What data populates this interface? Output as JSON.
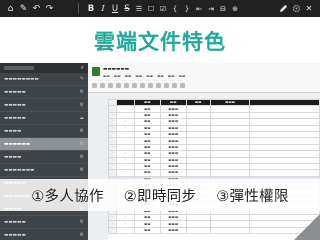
{
  "toolbar": {
    "left_icons": [
      "home-icon",
      "edit-square-icon",
      "undo-icon",
      "redo-icon"
    ],
    "format": [
      "B",
      "I",
      "U",
      "S"
    ],
    "format_icons": [
      "checklist-icon",
      "checkbox-icon",
      "checkbox-icon",
      "braces-icon",
      "code-icon",
      "outdent-icon",
      "indent-icon",
      "circle-plus-icon"
    ],
    "right_icons": [
      "pen-icon",
      "gear-icon",
      "close-icon"
    ]
  },
  "slide": {
    "title": "雲端文件特色",
    "title_color": "#1fa99a",
    "features": [
      "①多人協作",
      "②即時同步",
      "③彈性權限"
    ]
  }
}
